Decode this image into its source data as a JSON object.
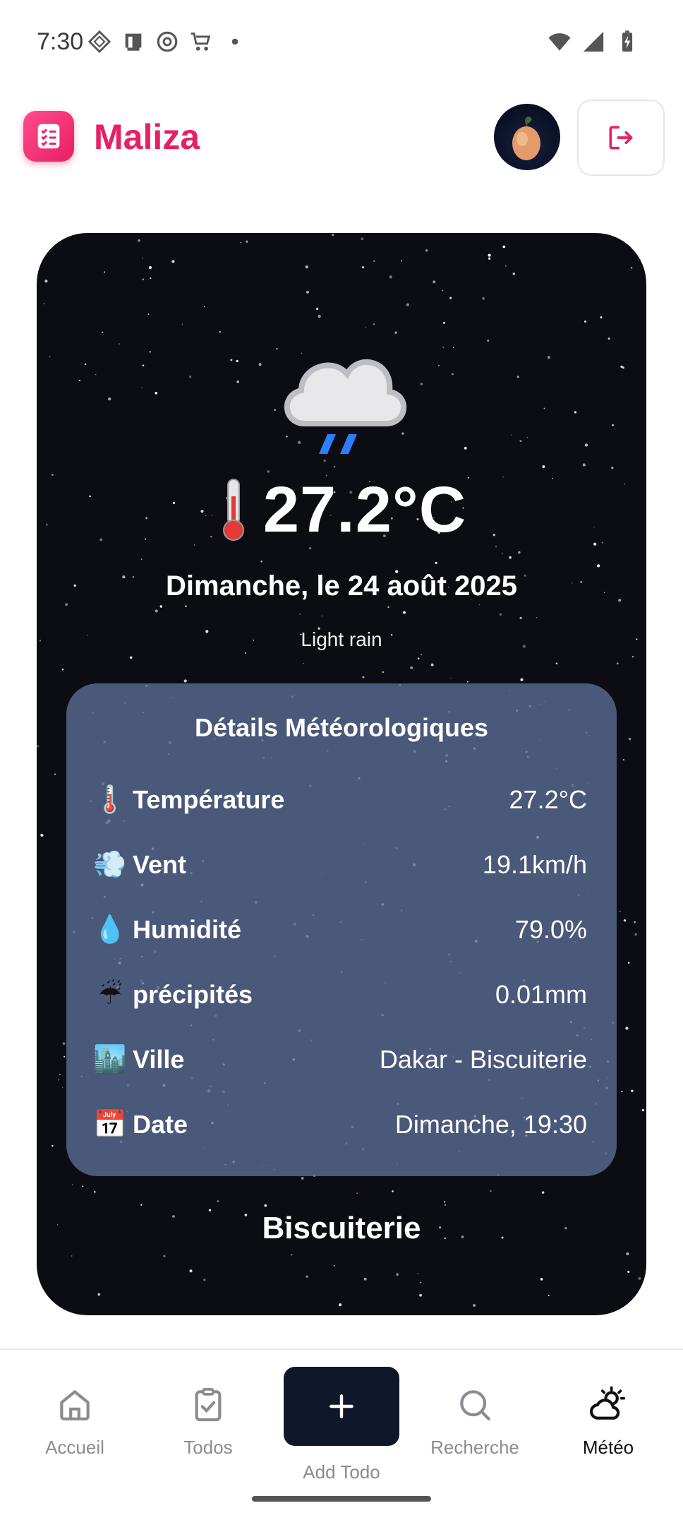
{
  "status_bar": {
    "time": "7:30"
  },
  "app": {
    "title": "Maliza",
    "brand_color": "#e91e63"
  },
  "weather": {
    "temperature": "27.2°C",
    "date": "Dimanche, le 24 août 2025",
    "condition": "Light rain",
    "details_title": "Détails Météorologiques",
    "details": [
      {
        "emoji": "🌡️",
        "label": "Température",
        "value": "27.2°C"
      },
      {
        "emoji": "💨",
        "label": "Vent",
        "value": "19.1km/h"
      },
      {
        "emoji": "💧",
        "label": "Humidité",
        "value": "79.0%"
      },
      {
        "emoji": "☔",
        "label": "précipités",
        "value": "0.01mm"
      },
      {
        "emoji": "🏙️",
        "label": "Ville",
        "value": "Dakar - Biscuiterie"
      },
      {
        "emoji": "📅",
        "label": "Date",
        "value": "Dimanche, 19:30"
      }
    ],
    "city": "Biscuiterie"
  },
  "nav": {
    "items": [
      {
        "label": "Accueil",
        "icon": "home-icon"
      },
      {
        "label": "Todos",
        "icon": "clipboard-check-icon"
      },
      {
        "label": "Recherche",
        "icon": "search-icon"
      },
      {
        "label": "Météo",
        "icon": "weather-icon"
      }
    ],
    "add_label": "Add Todo"
  }
}
